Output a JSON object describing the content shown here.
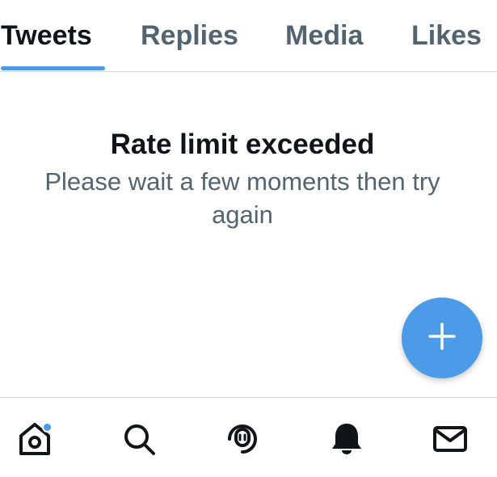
{
  "tabs": [
    {
      "label": "Tweets",
      "active": true
    },
    {
      "label": "Replies",
      "active": false
    },
    {
      "label": "Media",
      "active": false
    },
    {
      "label": "Likes",
      "active": false
    }
  ],
  "message": {
    "title": "Rate limit exceeded",
    "body": "Please wait a few moments then try again"
  },
  "fab": {
    "icon": "plus-icon"
  },
  "bottom_nav": [
    {
      "icon": "home-icon",
      "has_notification_dot": true
    },
    {
      "icon": "search-icon"
    },
    {
      "icon": "spaces-microphone-icon"
    },
    {
      "icon": "bell-icon"
    },
    {
      "icon": "mail-icon"
    }
  ],
  "colors": {
    "accent": "#4c9be8",
    "text_primary": "#0f1419",
    "text_secondary": "#536471",
    "divider": "#d6dadd"
  }
}
